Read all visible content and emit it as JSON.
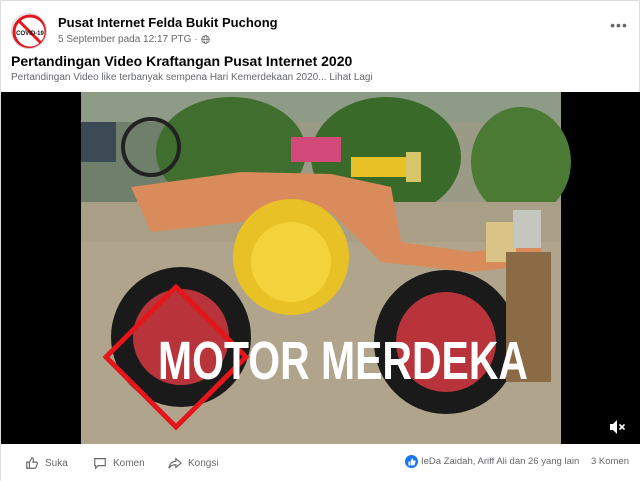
{
  "post": {
    "page_name": "Pusat Internet Felda Bukit Puchong",
    "timestamp": "5 September pada 12:17 PTG",
    "separator": "·",
    "audience_icon": "globe-icon",
    "title": "Pertandingan Video Kraftangan Pusat Internet 2020",
    "description": "Pertandingan Video like terbanyak sempena Hari Kemerdekaan 2020... Lihat Lagi",
    "more_label": "•••",
    "avatar_badge": "COVID-19"
  },
  "video": {
    "overlay_text": "MOTOR MERDEKA",
    "accent_color": "#e3161b",
    "volume_icon": "volume-mute-icon"
  },
  "actions": {
    "like_label": "Suka",
    "comment_label": "Komen",
    "share_label": "Kongsi"
  },
  "engagement": {
    "reactions_text": "IeDa Zaidah, Ariff Ali dan 26 yang lain",
    "comments_text": "3 Komen"
  },
  "colors": {
    "brand": "#1877f2",
    "secondary_text": "#65676b"
  }
}
